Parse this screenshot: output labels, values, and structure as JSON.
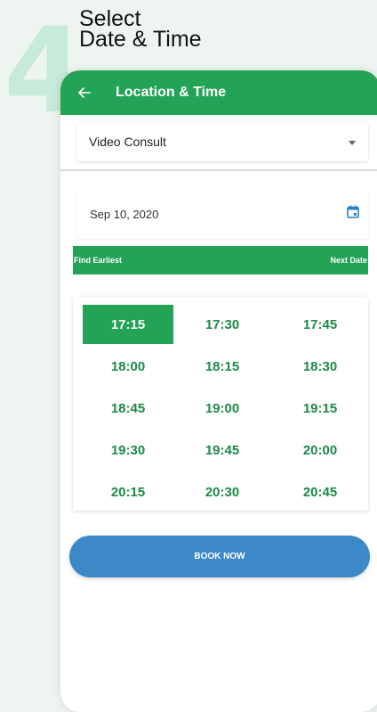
{
  "step": {
    "number": "4",
    "title_line1": "Select",
    "title_line2": "Date & Time"
  },
  "appbar": {
    "title": "Location & Time",
    "back_icon": "arrow-left-icon"
  },
  "consult_type": {
    "selected": "Video Consult",
    "dropdown_icon": "caret-down-icon"
  },
  "date": {
    "value": "Sep 10, 2020",
    "icon": "calendar-icon"
  },
  "date_nav": {
    "find_earliest": "Find Earliest",
    "next_date": "Next Date"
  },
  "time_slots": [
    "17:15",
    "17:30",
    "17:45",
    "18:00",
    "18:15",
    "18:30",
    "18:45",
    "19:00",
    "19:15",
    "19:30",
    "19:45",
    "20:00",
    "20:15",
    "20:30",
    "20:45"
  ],
  "selected_slot": "17:15",
  "book_button": "BOOK NOW",
  "colors": {
    "primary_green": "#22a356",
    "slot_text": "#1c8a47",
    "book_blue": "#3d88c6",
    "step_number": "#c8ead8"
  }
}
